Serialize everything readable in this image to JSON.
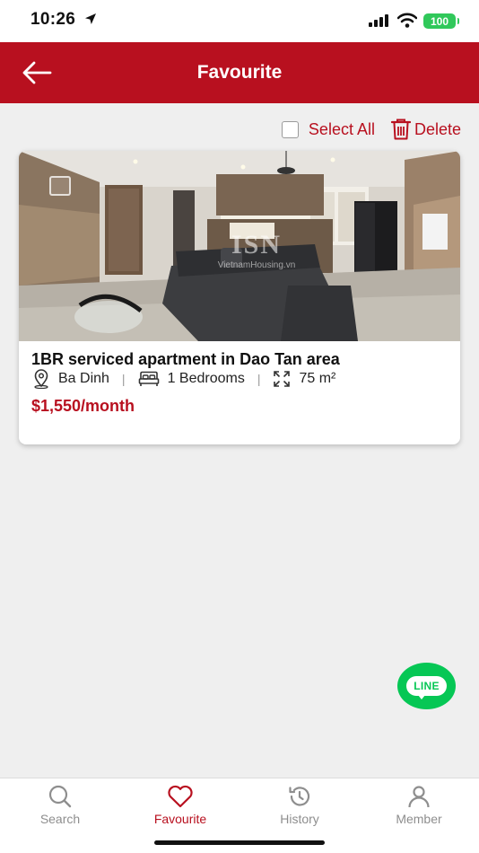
{
  "status_bar": {
    "time": "10:26",
    "battery": "100"
  },
  "header": {
    "title": "Favourite"
  },
  "toolbar": {
    "select_all_label": "Select All",
    "delete_label": "Delete"
  },
  "listings": [
    {
      "title": "1BR serviced apartment in Dao Tan area",
      "district": "Ba Dinh",
      "bedrooms": "1 Bedrooms",
      "area": "75 m²",
      "price": "$1,550/month",
      "watermark_logo": "ISN",
      "watermark_text": "VietnamHousing.vn"
    }
  ],
  "floating_button": {
    "label": "LINE"
  },
  "tabs": [
    {
      "label": "Search",
      "icon": "search-icon",
      "active": false
    },
    {
      "label": "Favourite",
      "icon": "heart-icon",
      "active": true
    },
    {
      "label": "History",
      "icon": "history-icon",
      "active": false
    },
    {
      "label": "Member",
      "icon": "person-icon",
      "active": false
    }
  ],
  "colors": {
    "brand_red": "#b8101f",
    "line_green": "#06c755",
    "battery_green": "#30c85a",
    "inactive_gray": "#8e8e8e"
  }
}
